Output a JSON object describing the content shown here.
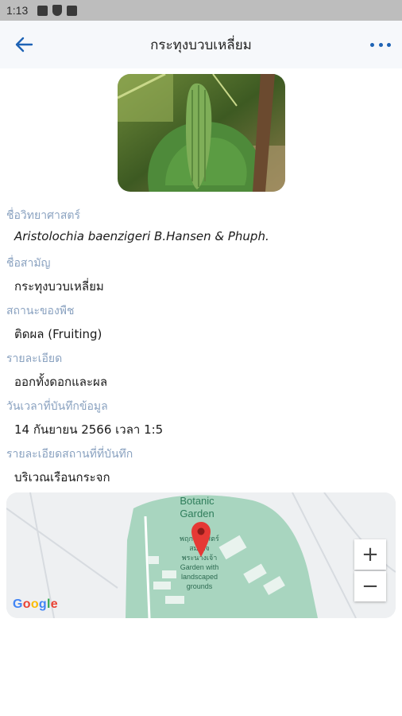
{
  "status_bar": {
    "time": "1:13"
  },
  "app_bar": {
    "title": "กระทุงบวบเหลี่ยม"
  },
  "fields": [
    {
      "label": "ชื่อวิทยาศาสตร์",
      "value": "Aristolochia baenzigeri B.Hansen & Phuph."
    },
    {
      "label": "ชื่อสามัญ",
      "value": "กระทุงบวบเหลี่ยม"
    },
    {
      "label": "สถานะของพืช",
      "value": "ติดผล (Fruiting)"
    },
    {
      "label": "รายละเอียด",
      "value": "ออกทั้งดอกและผล"
    },
    {
      "label": "วันเวลาที่บันทึกข้อมูล",
      "value": "14 กันยายน 2566 เวลา 1:5"
    },
    {
      "label": "รายละเอียดสถานที่ที่บันทึก",
      "value": "บริเวณเรือนกระจก"
    }
  ],
  "map": {
    "place_title_line1": "Botanic",
    "place_title_line2": "Garden",
    "marker_caption": [
      "พฤกษศาสตร์",
      "สมเด็จ",
      "พระนางเจ้า",
      "Garden with",
      "landscaped",
      "grounds"
    ],
    "zoom_in": "+",
    "zoom_out": "−",
    "attribution": "Google"
  },
  "colors": {
    "accent": "#1e63b5",
    "label": "#8aa2c0",
    "map_green": "#a8d5bf",
    "marker": "#e53935"
  }
}
